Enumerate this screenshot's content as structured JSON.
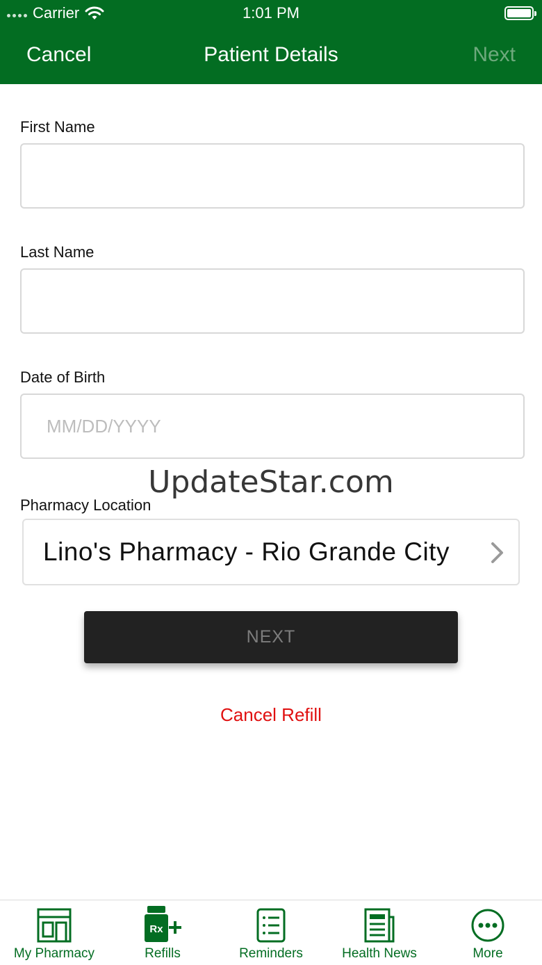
{
  "status_bar": {
    "carrier": "Carrier",
    "time": "1:01 PM"
  },
  "nav": {
    "cancel_label": "Cancel",
    "title": "Patient Details",
    "next_label": "Next"
  },
  "form": {
    "first_name": {
      "label": "First Name",
      "value": "",
      "placeholder": ""
    },
    "last_name": {
      "label": "Last Name",
      "value": "",
      "placeholder": ""
    },
    "dob": {
      "label": "Date of Birth",
      "value": "",
      "placeholder": "MM/DD/YYYY"
    },
    "pharmacy": {
      "label": "Pharmacy Location",
      "value": "Lino's Pharmacy - Rio Grande City"
    }
  },
  "watermark": "UpdateStar.com",
  "next_button_label": "NEXT",
  "cancel_refill_label": "Cancel Refill",
  "tabs": [
    {
      "label": "My Pharmacy",
      "icon": "pharmacy-store-icon"
    },
    {
      "label": "Refills",
      "icon": "rx-refill-icon"
    },
    {
      "label": "Reminders",
      "icon": "reminders-list-icon"
    },
    {
      "label": "Health News",
      "icon": "newspaper-icon"
    },
    {
      "label": "More",
      "icon": "more-dots-icon"
    }
  ],
  "colors": {
    "brand_green": "#036d22",
    "cancel_red": "#e01010",
    "button_dark": "#222222"
  }
}
